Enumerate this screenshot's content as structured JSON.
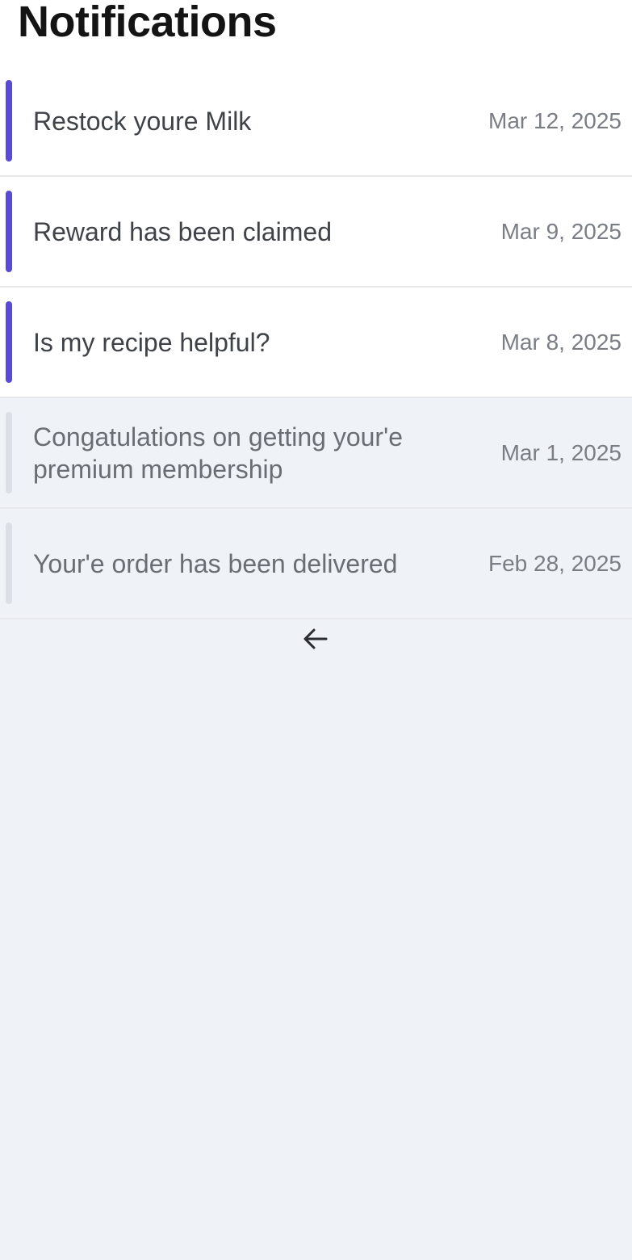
{
  "header": {
    "title": "Notifications"
  },
  "notifications": [
    {
      "message": "Restock youre Milk",
      "date": "Mar 12, 2025",
      "status": "unread"
    },
    {
      "message": "Reward has been claimed",
      "date": "Mar 9, 2025",
      "status": "unread"
    },
    {
      "message": "Is my recipe helpful?",
      "date": "Mar 8, 2025",
      "status": "unread"
    },
    {
      "message": "Congatulations on getting your'e premium membership",
      "date": "Mar 1, 2025",
      "status": "read"
    },
    {
      "message": "Your'e order has been delivered",
      "date": "Feb 28, 2025",
      "status": "read"
    }
  ],
  "footer": {
    "back_icon": "arrow-left-icon"
  },
  "colors": {
    "accent": "#5a4bd6",
    "read_bar": "#dcdfe5",
    "background": "#eff2f7",
    "unread_background": "#ffffff"
  }
}
